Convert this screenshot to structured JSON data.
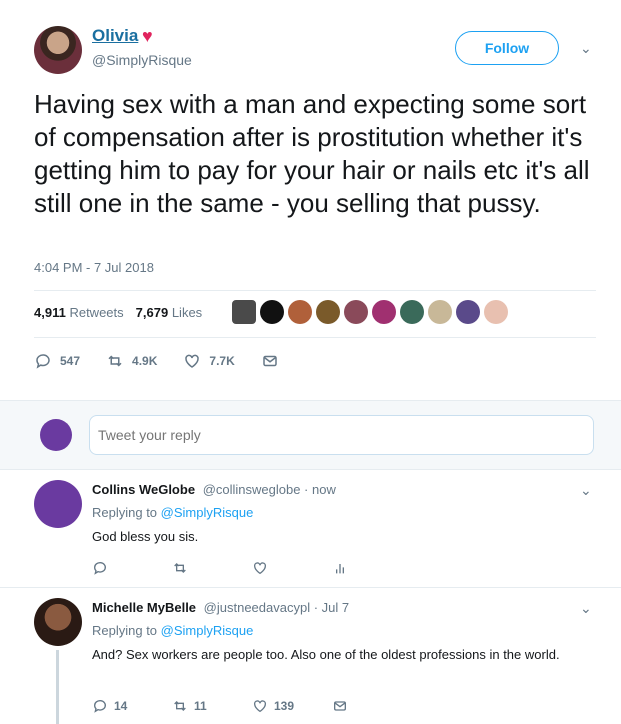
{
  "main_tweet": {
    "author_name": "Olivia",
    "author_emoji": "♥",
    "handle": "@SimplyRisque",
    "follow_label": "Follow",
    "text": "Having sex with a man and expecting some sort of compensation after is prostitution whether it's getting him to pay for your hair or nails etc it's all still one in the same - you selling that pussy.",
    "timestamp": "4:04 PM - 7 Jul 2018",
    "retweets_count": "4,911",
    "retweets_label": "Retweets",
    "likes_count": "7,679",
    "likes_label": "Likes",
    "actions": {
      "replies": "547",
      "retweets": "4.9K",
      "likes": "7.7K"
    }
  },
  "reply_box": {
    "placeholder": "Tweet your reply"
  },
  "replies": [
    {
      "name": "Collins WeGlobe",
      "handle": "@collinsweglobe",
      "time": "now",
      "replying_to_label": "Replying to",
      "replying_to": "@SimplyRisque",
      "text": "God bless you sis.",
      "actions": {
        "replies": "",
        "retweets": "",
        "likes": ""
      }
    },
    {
      "name": "Michelle MyBelle",
      "handle": "@justneedavacypl",
      "time": "Jul 7",
      "replying_to_label": "Replying to",
      "replying_to": "@SimplyRisque",
      "text": "And? Sex workers are people too.  Also one of the oldest professions in the world.",
      "actions": {
        "replies": "14",
        "retweets": "11",
        "likes": "139"
      }
    }
  ],
  "colors": {
    "accent": "#1da1f2",
    "name_link": "#1a6fa0",
    "muted": "#657786"
  }
}
